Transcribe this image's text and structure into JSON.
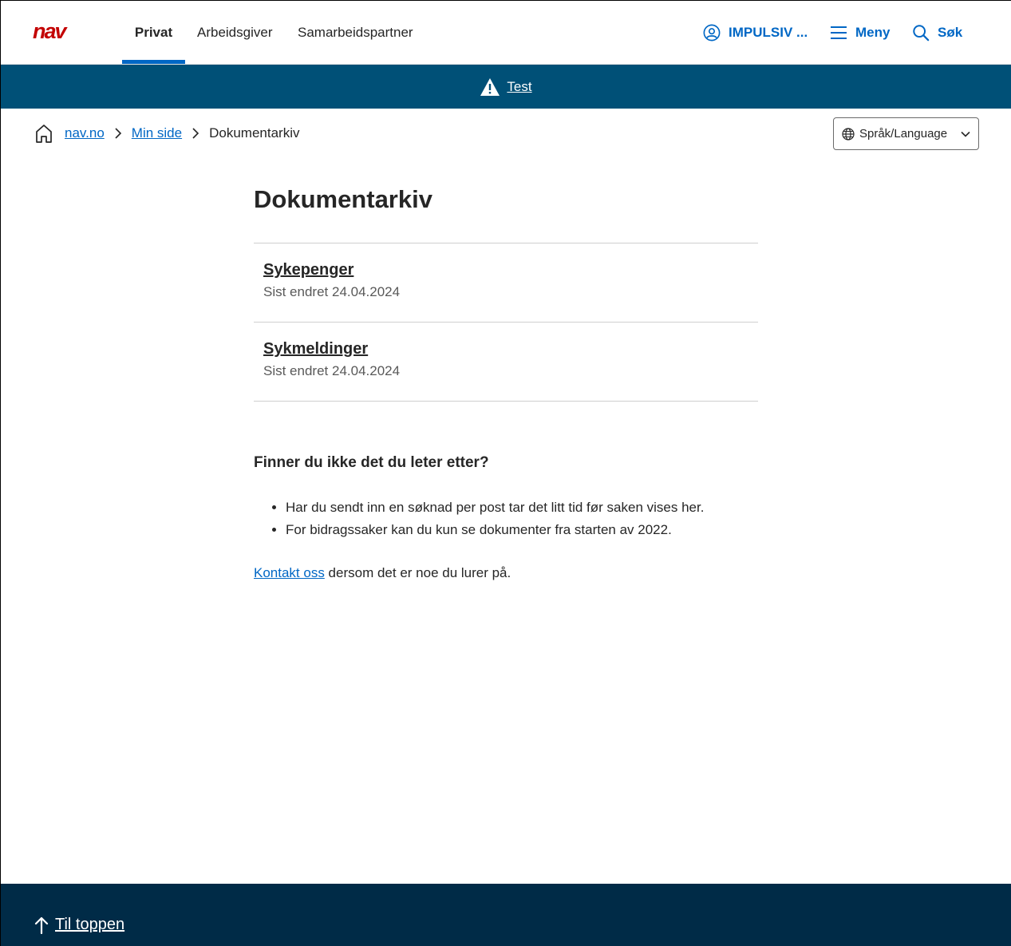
{
  "header": {
    "logo_text": "nav",
    "tabs": [
      {
        "label": "Privat",
        "active": true
      },
      {
        "label": "Arbeidsgiver",
        "active": false
      },
      {
        "label": "Samarbeidspartner",
        "active": false
      }
    ],
    "user_label": "IMPULSIV ...",
    "menu_label": "Meny",
    "search_label": "Søk",
    "accent_color": "#0067c5",
    "logo_color": "#c30000"
  },
  "banner": {
    "text": "Test",
    "icon": "warning-triangle-icon",
    "background": "#005077"
  },
  "breadcrumb": {
    "items": [
      {
        "label": "nav.no",
        "link": true
      },
      {
        "label": "Min side",
        "link": true
      },
      {
        "label": "Dokumentarkiv",
        "link": false
      }
    ]
  },
  "language": {
    "label": "Språk/Language"
  },
  "main": {
    "title": "Dokumentarkiv",
    "documents": [
      {
        "title": "Sykepenger",
        "date": "Sist endret 24.04.2024"
      },
      {
        "title": "Sykmeldinger",
        "date": "Sist endret 24.04.2024"
      }
    ],
    "help": {
      "heading": "Finner du ikke det du leter etter?",
      "bullets": [
        "Har du sendt inn en søknad per post tar det litt tid før saken vises her.",
        "For bidragssaker kan du kun se dokumenter fra starten av 2022."
      ],
      "contact_link": "Kontakt oss",
      "contact_rest": " dersom det er noe du lurer på."
    }
  },
  "footer": {
    "to_top_label": "Til toppen",
    "background": "#002b47"
  }
}
